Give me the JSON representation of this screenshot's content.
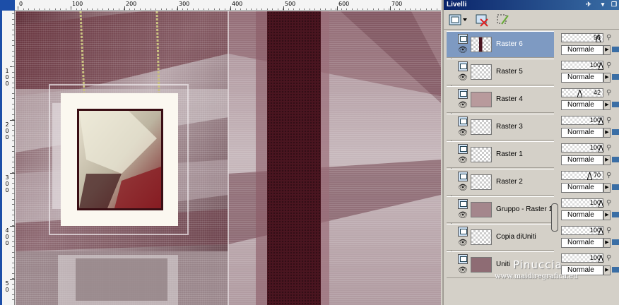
{
  "ruler": {
    "h_labels": [
      "0",
      "100",
      "200",
      "300",
      "400",
      "500",
      "600",
      "700"
    ],
    "v_labels": [
      "1\n0\n0",
      "2\n0\n0",
      "3\n0\n0",
      "4\n0\n0",
      "5\n0"
    ]
  },
  "layers_panel": {
    "title": "Livelli",
    "pin_icon": "pin-icon",
    "close_icon": "close-icon",
    "toolbar": {
      "new_layer_icon": "new-raster-layer-icon",
      "delete_icon": "delete-layer-icon",
      "mask_icon": "edit-selection-icon"
    },
    "layers": [
      {
        "name": "Raster 6",
        "opacity": "93",
        "blend": "Normale",
        "selected": true
      },
      {
        "name": "Raster 5",
        "opacity": "100",
        "blend": "Normale",
        "selected": false
      },
      {
        "name": "Raster 4",
        "opacity": "42",
        "blend": "Normale",
        "selected": false
      },
      {
        "name": "Raster 3",
        "opacity": "100",
        "blend": "Normale",
        "selected": false
      },
      {
        "name": "Raster 1",
        "opacity": "100",
        "blend": "Normale",
        "selected": false
      },
      {
        "name": "Raster 2",
        "opacity": "70",
        "blend": "Normale",
        "selected": false
      },
      {
        "name": "Gruppo - Raster 1",
        "opacity": "100",
        "blend": "Normale",
        "selected": false
      },
      {
        "name": "Copia diUniti",
        "opacity": "100",
        "blend": "Normale",
        "selected": false
      },
      {
        "name": "Uniti",
        "opacity": "100",
        "blend": "Normale",
        "selected": false
      }
    ]
  },
  "watermark": {
    "name": "Pinuccia",
    "url": "www.maidiregrafica.eu"
  },
  "colors": {
    "selected_row": "#7e9ac2",
    "title_bar": "#0a246a",
    "canvas_main": "#8c6b72",
    "dark_stripe": "#4a1520"
  }
}
